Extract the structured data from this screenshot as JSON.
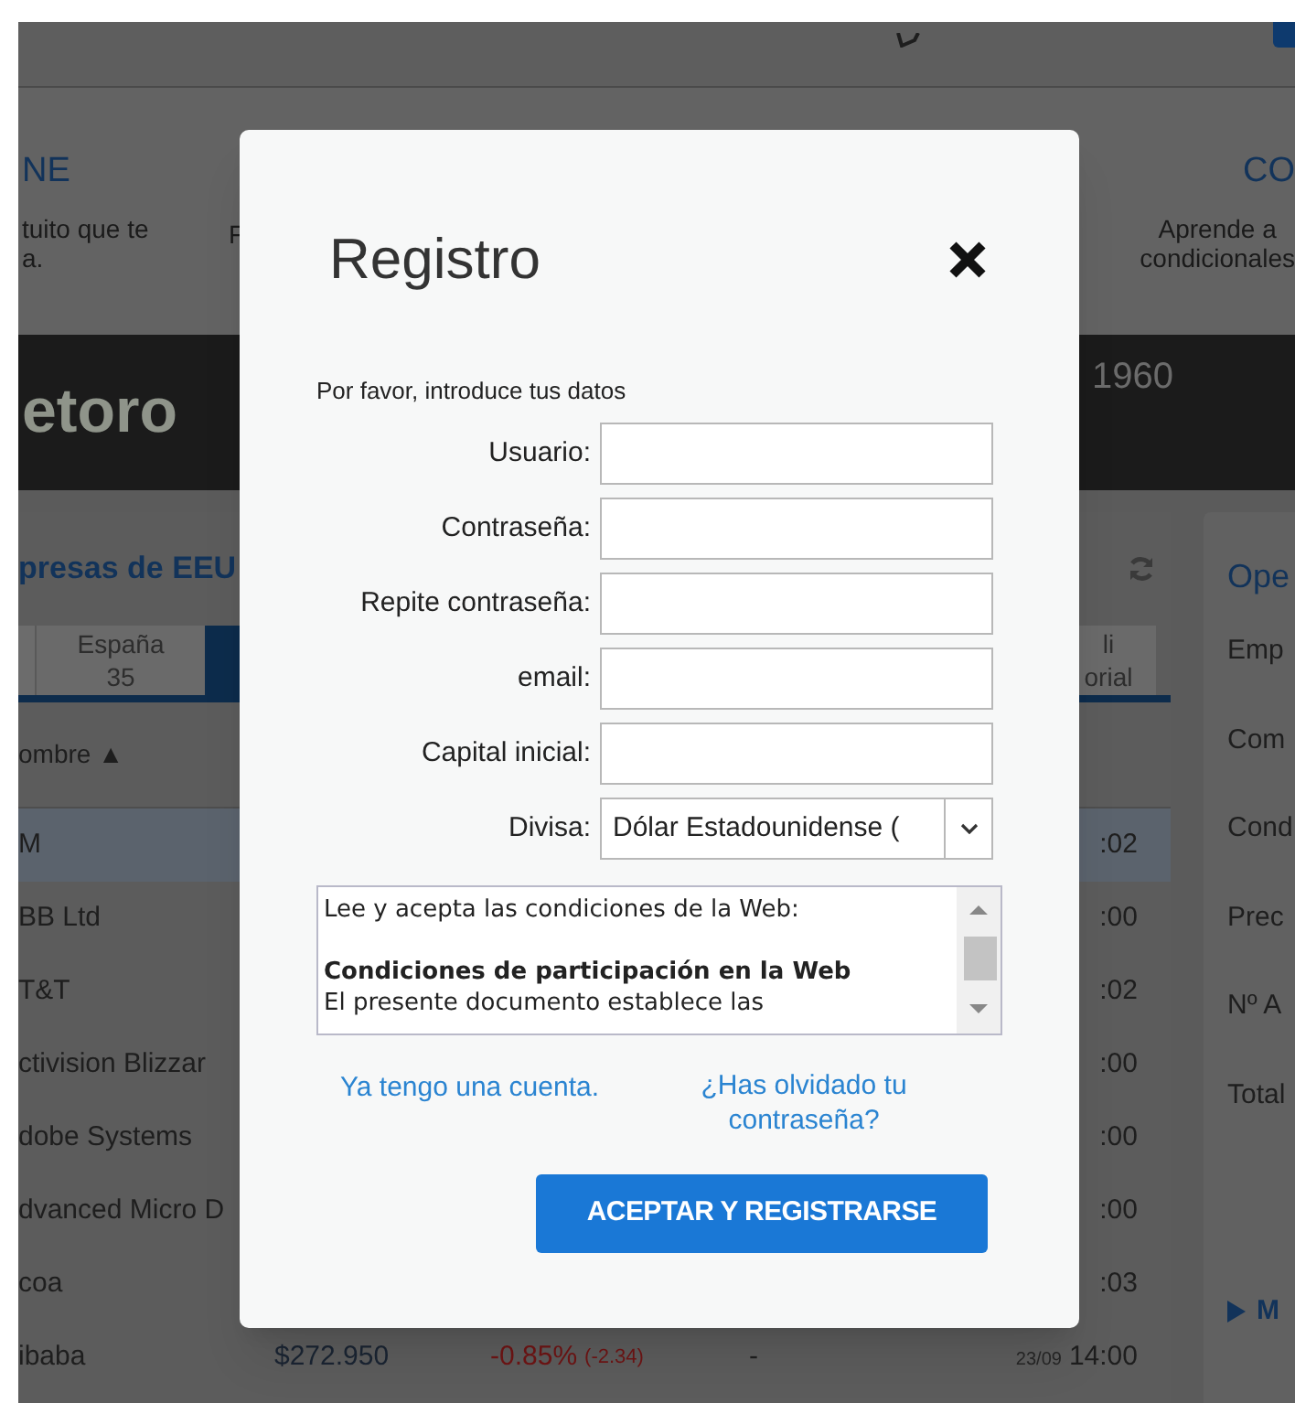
{
  "header": {
    "promo_left": {
      "title": "NE",
      "lines": [
        "tuito que te",
        "a."
      ]
    },
    "promo_middle": {
      "text": "F"
    },
    "promo_right": {
      "title": "CO",
      "lines": [
        "Aprende a",
        "condicionales"
      ]
    }
  },
  "banner": {
    "logo": "etoro",
    "text": "1960"
  },
  "market_panel": {
    "title": "presas de EEU",
    "tabs": [
      {
        "label": "España\n35",
        "selected": false
      },
      {
        "selected": true
      },
      {
        "label": "li\norial",
        "selected": false
      }
    ],
    "column_header": "ombre ▲",
    "rows": [
      {
        "name": "M",
        "time": ":02",
        "selected": true
      },
      {
        "name": "BB Ltd",
        "time": ":00",
        "selected": false
      },
      {
        "name": "T&T",
        "time": ":02",
        "selected": false
      },
      {
        "name": "ctivision Blizzar",
        "time": ":00",
        "selected": false
      },
      {
        "name": "dobe Systems",
        "time": ":00",
        "selected": false
      },
      {
        "name": "dvanced Micro D",
        "time": ":00",
        "selected": false
      },
      {
        "name": "coa",
        "time": ":03",
        "selected": false
      },
      {
        "name": "ibaba",
        "price": "$272.950",
        "change": "-0.85%",
        "change_abs": "(-2.34)",
        "volume": "-",
        "date": "23/09",
        "time": "14:00",
        "selected": false
      }
    ]
  },
  "order_panel": {
    "title": "Ope",
    "labels": [
      "Emp",
      "Com",
      "Cond",
      "Prec",
      "Nº A",
      "Total"
    ],
    "more": "M"
  },
  "dialog": {
    "title": "Registro",
    "intro": "Por favor, introduce tus datos",
    "fields": [
      {
        "kind": "text",
        "label": "Usuario:"
      },
      {
        "kind": "password",
        "label": "Contraseña:"
      },
      {
        "kind": "password",
        "label": "Repite contraseña:"
      },
      {
        "kind": "text",
        "label": "email:"
      },
      {
        "kind": "text",
        "label": "Capital inicial:"
      },
      {
        "kind": "select",
        "label": "Divisa:",
        "value": "Dólar Estadounidense ("
      }
    ],
    "terms": [
      {
        "kind": "text",
        "text": "Lee y acepta las condiciones de la Web:"
      },
      {
        "kind": "gap"
      },
      {
        "kind": "heading",
        "text": "Condiciones de participación en la Web"
      },
      {
        "kind": "text",
        "text": "El presente documento establece las"
      }
    ],
    "links": [
      "Ya tengo una cuenta.",
      "¿Has olvidado tu contraseña?"
    ],
    "submit": "ACEPTAR Y REGISTRARSE"
  }
}
